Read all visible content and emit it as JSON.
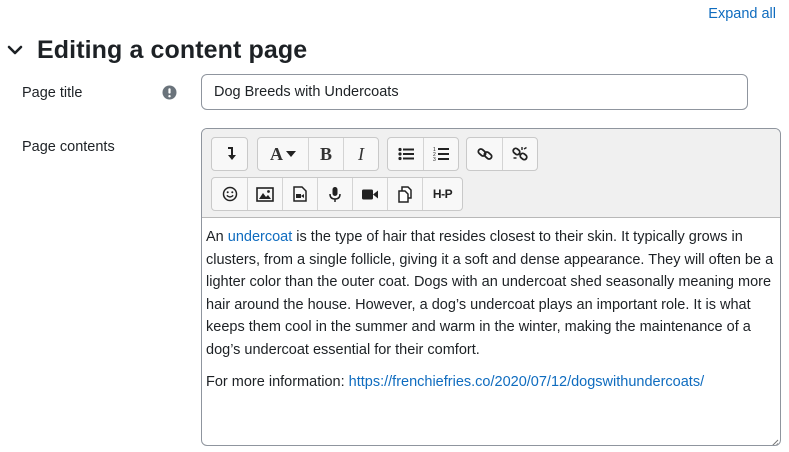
{
  "header": {
    "expand_all": "Expand all",
    "section_title": "Editing a content page"
  },
  "form": {
    "page_title_label": "Page title",
    "page_title_value": "Dog Breeds with Undercoats",
    "page_contents_label": "Page contents"
  },
  "toolbar": {
    "font_label": "A",
    "bold_label": "B",
    "italic_label": "I",
    "h5p_label": "H-P",
    "icons": [
      "collapse-icon",
      "font-style-icon",
      "bold-icon",
      "italic-icon",
      "unordered-list-icon",
      "ordered-list-icon",
      "link-icon",
      "unlink-icon",
      "emoji-icon",
      "image-icon",
      "media-icon",
      "record-audio-icon",
      "record-video-icon",
      "manage-files-icon",
      "h5p-icon"
    ]
  },
  "content": {
    "p1_prefix": "An ",
    "p1_link": "undercoat",
    "p1_rest": " is the type of hair that resides closest to their skin. It typically grows in clusters, from a single follicle, giving it a soft and dense appearance. They will often be a lighter color than the outer coat. Dogs with an undercoat shed seasonally meaning more hair around the house. However, a dog’s undercoat plays an important role. It is what keeps them cool in the summer and warm in the winter, making the maintenance of a dog’s undercoat essential for their comfort.",
    "p2_prefix": "For more information: ",
    "p2_link": "https://frenchiefries.co/2020/07/12/dogswithundercoats/"
  },
  "colors": {
    "link": "#0f6cbf",
    "required": "#6a737b",
    "toolbar_bg": "#f0f0f0"
  }
}
